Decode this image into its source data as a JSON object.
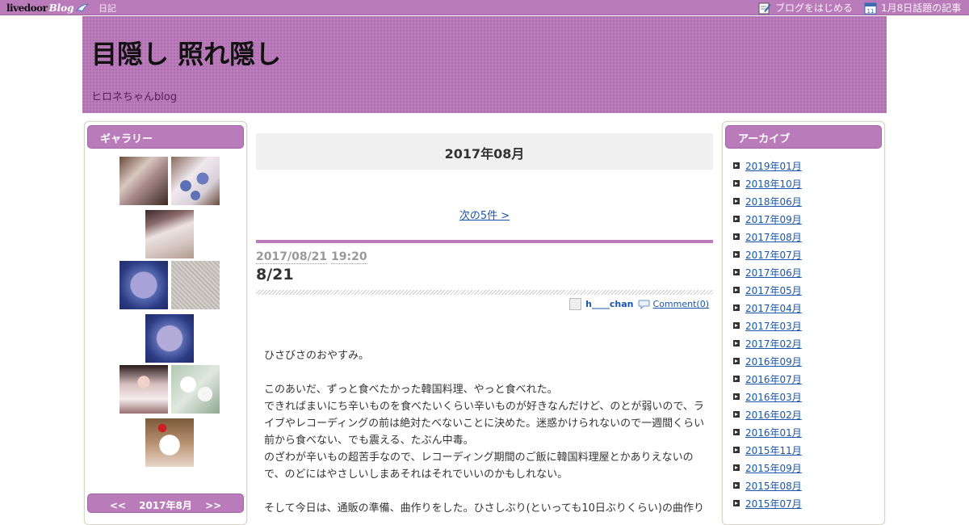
{
  "topbar": {
    "logo_livedoor": "livedoor",
    "logo_blog": "Blog",
    "diary": "日記",
    "start_blog": "ブログをはじめる",
    "topics": "1月8日話題の記事",
    "calendar_day": "11"
  },
  "header": {
    "title": "目隠し 照れ隠し",
    "subtitle": "ヒロネちゃんblog"
  },
  "sidebar_left": {
    "gallery_title": "ギャラリー",
    "calendar_prev": "<<",
    "calendar_month": "2017年8月",
    "calendar_next": ">>"
  },
  "sidebar_right": {
    "archive_title": "アーカイブ",
    "archives": [
      "2019年01月",
      "2018年10月",
      "2018年06月",
      "2017年09月",
      "2017年08月",
      "2017年07月",
      "2017年06月",
      "2017年05月",
      "2017年04月",
      "2017年03月",
      "2017年02月",
      "2016年09月",
      "2016年07月",
      "2016年03月",
      "2016年02月",
      "2016年01月",
      "2015年11月",
      "2015年09月",
      "2015年08月",
      "2015年07月"
    ]
  },
  "main": {
    "month_heading": "2017年08月",
    "next_link": "次の5件 >",
    "entry": {
      "date": "2017/08/21",
      "time": "19:20",
      "title": "8/21",
      "author": "h____chan",
      "comments": "Comment(0)",
      "body": [
        "ひさびさのおやすみ。",
        "",
        "このあいだ、ずっと食べたかった韓国料理、やっと食べれた。",
        "できればまいにち辛いものを食べたいくらい辛いものが好きなんだけど、のとが弱いので、ライブやレコーディングの前は絶対たべないことに決めた。迷惑かけられないので一週間くらい前から食べない、でも震える、たぶん中毒。",
        "のざわが辛いもの超苦手なので、レコーディング期間のご飯に韓国料理屋とかありえないので、のどにはやさしいしまあそれはそれでいいのかもしれない。",
        "",
        "そして今日は、通販の準備、曲作りをした。ひさしぶり(といっても10日ぶりくらい)の曲作り"
      ]
    }
  },
  "colors": {
    "accent": "#ba7bbb",
    "link": "#1a55a8"
  }
}
